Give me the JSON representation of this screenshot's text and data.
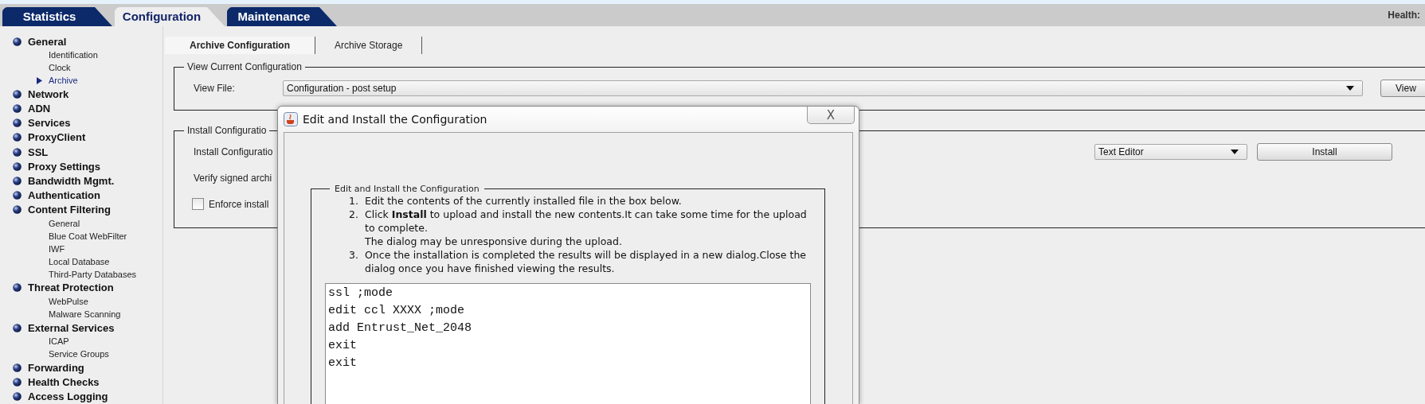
{
  "top_tabs": [
    {
      "label": "Statistics",
      "selected": false
    },
    {
      "label": "Configuration",
      "selected": true
    },
    {
      "label": "Maintenance",
      "selected": false
    }
  ],
  "health": {
    "label": "Health:"
  },
  "sidebar": {
    "items": [
      {
        "label": "General",
        "children": [
          {
            "label": "Identification",
            "selected": false
          },
          {
            "label": "Clock",
            "selected": false
          },
          {
            "label": "Archive",
            "selected": true
          }
        ]
      },
      {
        "label": "Network"
      },
      {
        "label": "ADN"
      },
      {
        "label": "Services"
      },
      {
        "label": "ProxyClient"
      },
      {
        "label": "SSL"
      },
      {
        "label": "Proxy Settings"
      },
      {
        "label": "Bandwidth Mgmt."
      },
      {
        "label": "Authentication"
      },
      {
        "label": "Content Filtering",
        "children": [
          {
            "label": "General",
            "selected": false
          },
          {
            "label": "Blue Coat WebFilter",
            "selected": false
          },
          {
            "label": "IWF",
            "selected": false
          },
          {
            "label": "Local Database",
            "selected": false
          },
          {
            "label": "Third-Party Databases",
            "selected": false
          }
        ]
      },
      {
        "label": "Threat Protection",
        "children": [
          {
            "label": "WebPulse",
            "selected": false
          },
          {
            "label": "Malware Scanning",
            "selected": false
          }
        ]
      },
      {
        "label": "External Services",
        "children": [
          {
            "label": "ICAP",
            "selected": false
          },
          {
            "label": "Service Groups",
            "selected": false
          }
        ]
      },
      {
        "label": "Forwarding"
      },
      {
        "label": "Health Checks"
      },
      {
        "label": "Access Logging"
      }
    ]
  },
  "sub_tabs": [
    {
      "label": "Archive Configuration",
      "selected": true
    },
    {
      "label": "Archive Storage",
      "selected": false
    }
  ],
  "view_section": {
    "legend": "View Current Configuration",
    "label": "View File:",
    "select_value": "Configuration - post setup",
    "button": "View"
  },
  "install_section": {
    "legend": "Install Configuratio",
    "label": "Install Configuratio",
    "method_value": "Text Editor",
    "button": "Install",
    "verify_label": "Verify signed archi",
    "enforce": {
      "label": "Enforce install",
      "checked": false
    }
  },
  "dialog": {
    "title": "Edit and Install the Configuration",
    "close": "X",
    "legend": "Edit and Install the Configuration",
    "steps": [
      {
        "number": "1.",
        "text": "Edit the contents of the currently installed file in the box below."
      },
      {
        "number": "2.",
        "text": "Click **Install** to upload and install the new contents.It can take some time for the upload to complete.",
        "note": "The dialog may be unresponsive during the upload."
      },
      {
        "number": "3.",
        "text": "Once the installation is completed the results will be displayed in a new dialog.Close the dialog once you have finished viewing the results."
      }
    ],
    "editor_lines": [
      "ssl ;mode",
      "edit ccl XXXX ;mode",
      "add Entrust_Net_2048",
      "exit",
      "exit"
    ]
  }
}
